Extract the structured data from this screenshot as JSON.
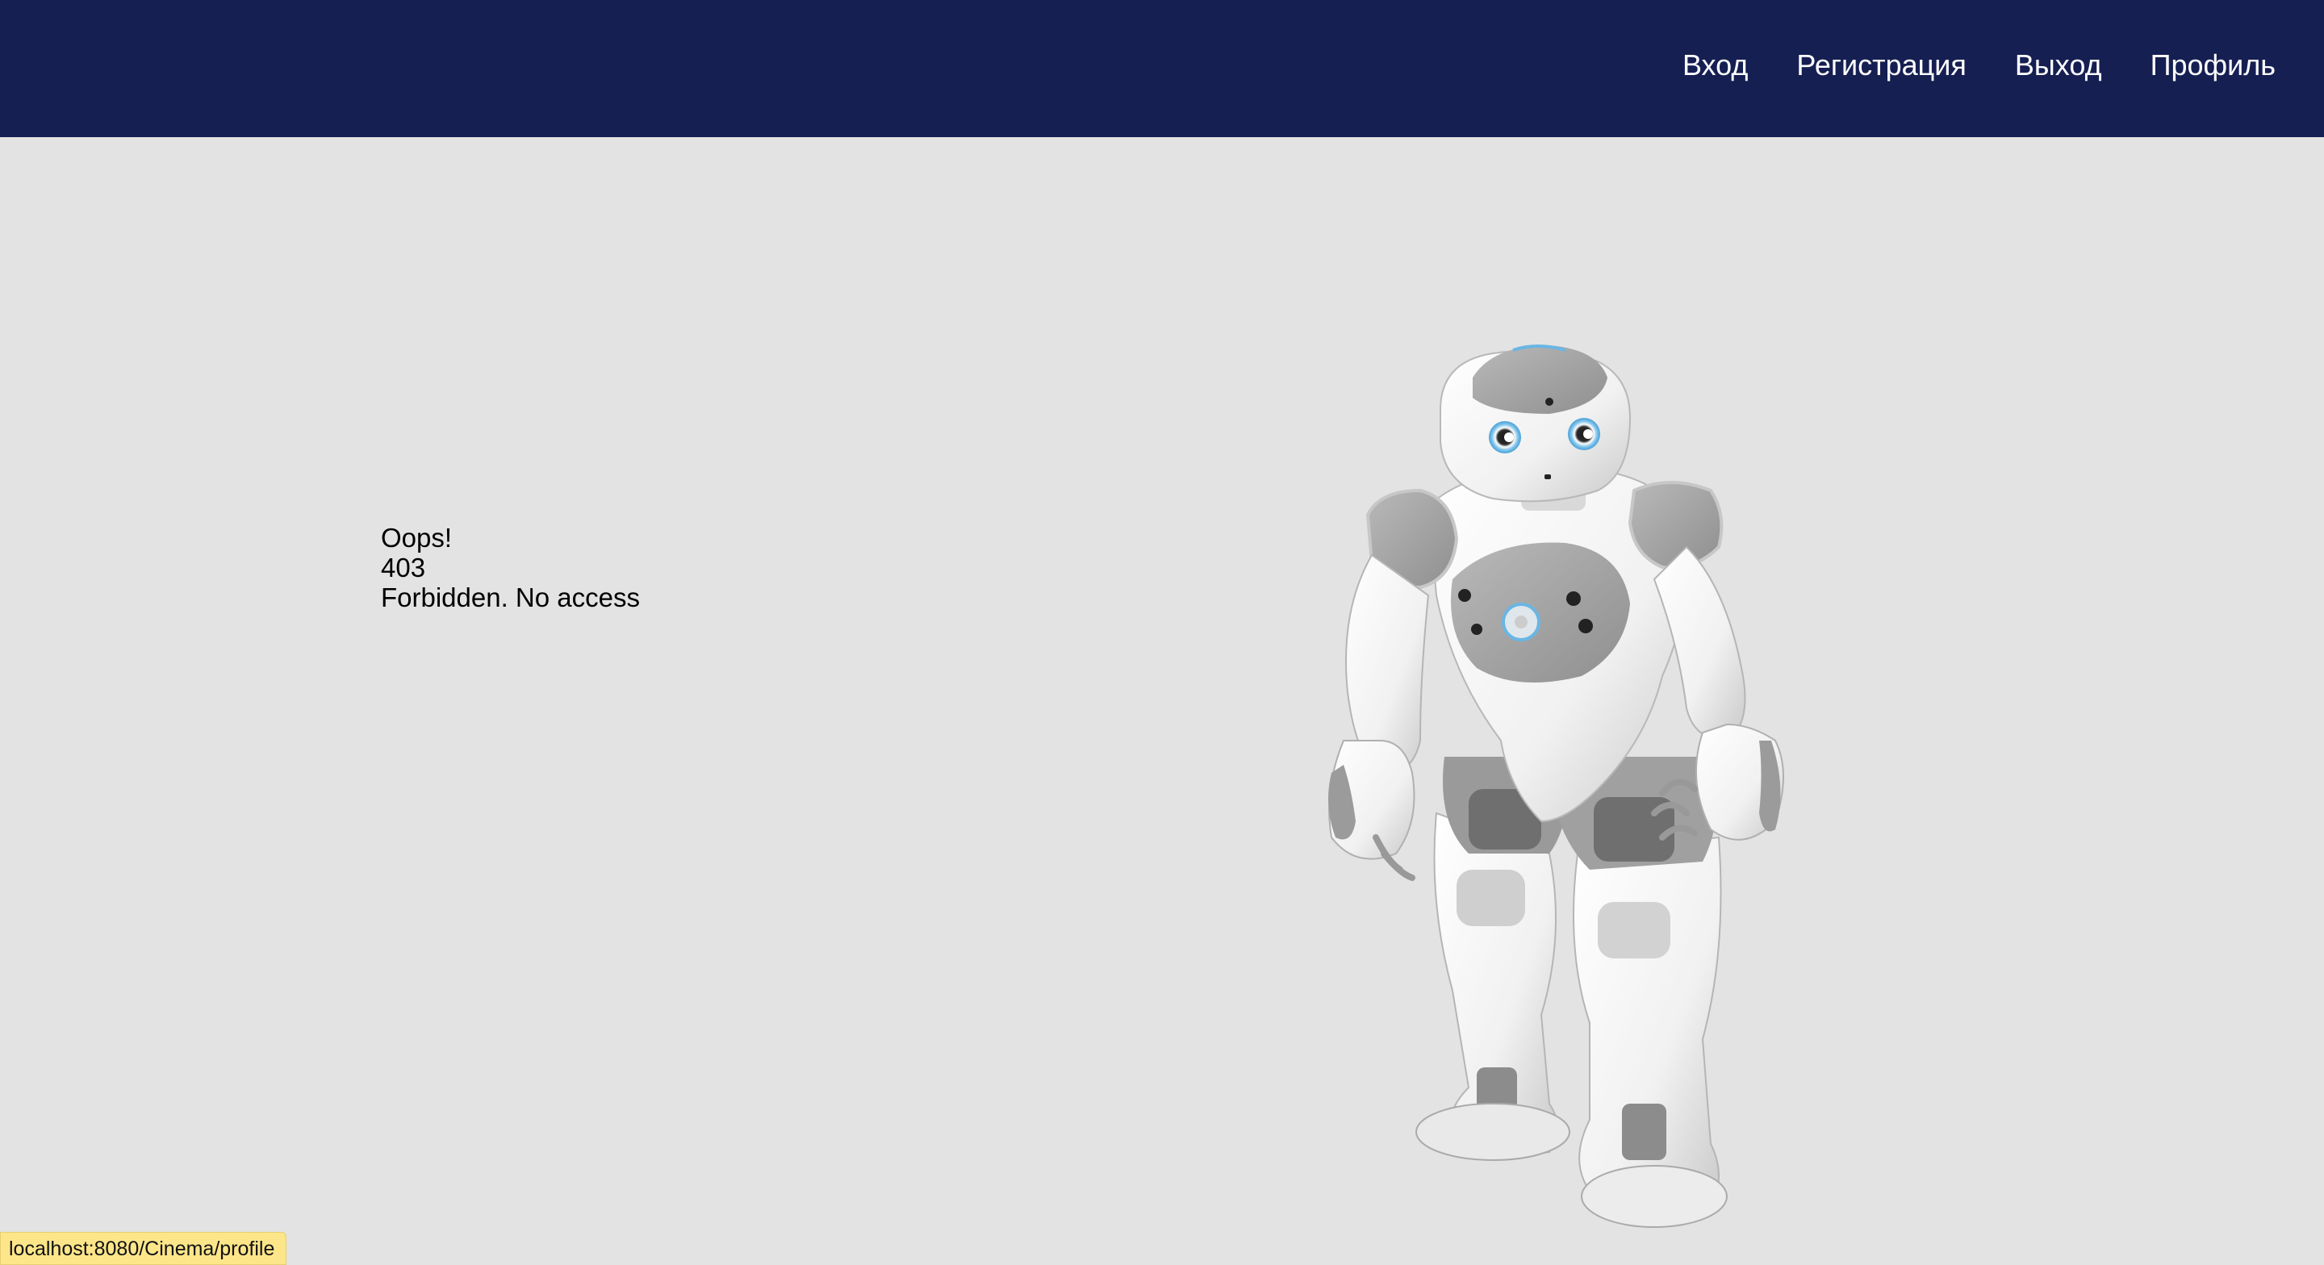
{
  "nav": {
    "links": [
      {
        "label": "Вход"
      },
      {
        "label": "Регистрация"
      },
      {
        "label": "Выход"
      },
      {
        "label": "Профиль"
      }
    ]
  },
  "error": {
    "line1": "Oops!",
    "line2": "403",
    "line3": "Forbidden. No access"
  },
  "status_bar": {
    "url": "localhost:8080/Cinema/profile"
  },
  "colors": {
    "navbar": "#161f52",
    "background": "#e3e3e3",
    "status_bar": "#fde68a"
  },
  "icons": {
    "hero": "robot-illustration"
  }
}
